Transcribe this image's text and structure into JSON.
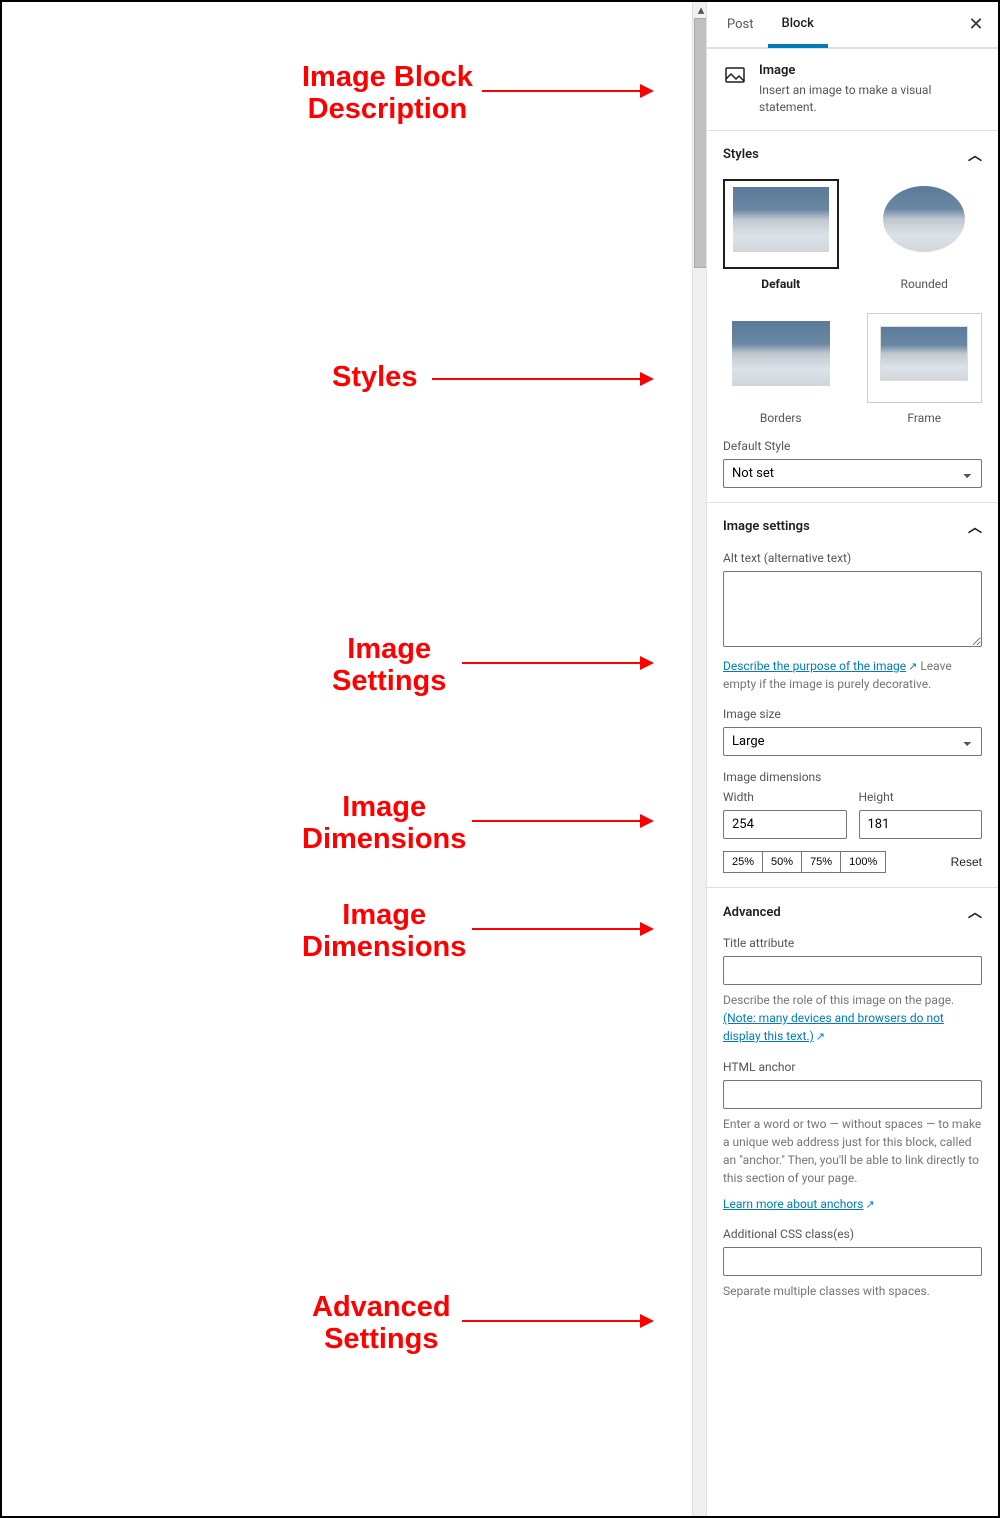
{
  "annotations": {
    "a1_l1": "Image Block",
    "a1_l2": "Description",
    "a2": "Styles",
    "a3_l1": "Image",
    "a3_l2": "Settings",
    "a4_l1": "Image",
    "a4_l2": "Dimensions",
    "a5_l1": "Image",
    "a5_l2": "Dimensions",
    "a6_l1": "Advanced",
    "a6_l2": "Settings"
  },
  "tabs": {
    "post": "Post",
    "block": "Block"
  },
  "block": {
    "title": "Image",
    "description": "Insert an image to make a visual statement."
  },
  "styles": {
    "heading": "Styles",
    "options": {
      "default": "Default",
      "rounded": "Rounded",
      "borders": "Borders",
      "frame": "Frame"
    },
    "default_style_label": "Default Style",
    "default_style_value": "Not set"
  },
  "image_settings": {
    "heading": "Image settings",
    "alt_label": "Alt text (alternative text)",
    "alt_value": "",
    "describe_link": "Describe the purpose of the image",
    "alt_help_suffix": "Leave empty if the image is purely decorative.",
    "size_label": "Image size",
    "size_value": "Large",
    "dimensions_label": "Image dimensions",
    "width_label": "Width",
    "height_label": "Height",
    "width_value": "254",
    "height_value": "181",
    "pct_25": "25%",
    "pct_50": "50%",
    "pct_75": "75%",
    "pct_100": "100%",
    "reset": "Reset"
  },
  "advanced": {
    "heading": "Advanced",
    "title_attr_label": "Title attribute",
    "title_attr_value": "",
    "title_help_prefix": "Describe the role of this image on the page.",
    "title_help_link": "(Note: many devices and browsers do not display this text.)",
    "anchor_label": "HTML anchor",
    "anchor_value": "",
    "anchor_help": "Enter a word or two — without spaces — to make a unique web address just for this block, called an \"anchor.\" Then, you'll be able to link directly to this section of your page.",
    "anchor_link": "Learn more about anchors",
    "css_label": "Additional CSS class(es)",
    "css_value": "",
    "css_help": "Separate multiple classes with spaces."
  }
}
